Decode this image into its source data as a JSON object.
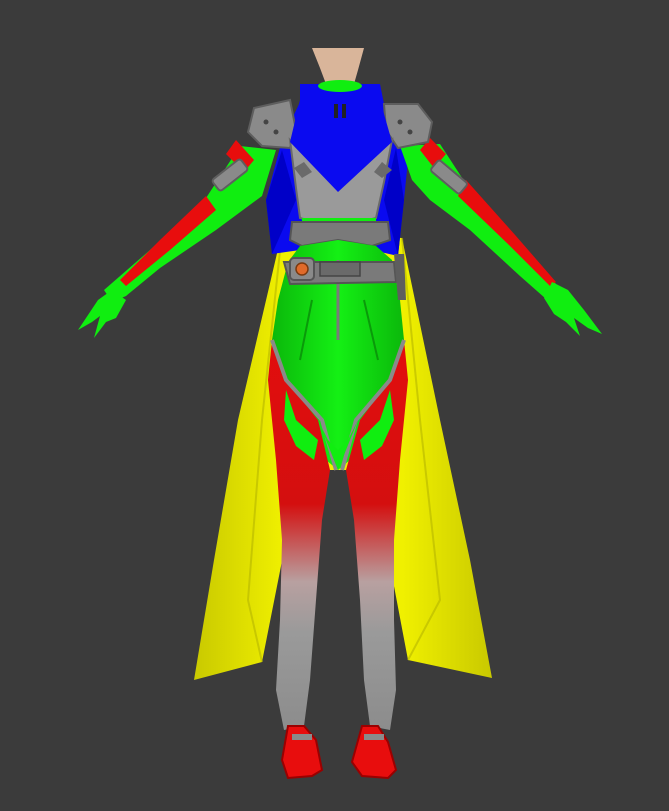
{
  "scene": {
    "background": "#3b3b3b",
    "subject": "costume-model-t-pose",
    "palette": {
      "cape": "#eeee00",
      "cape_shade": "#c8c800",
      "cowl": "#0a0af0",
      "cowl_shade": "#0000b4",
      "bodysuit": "#10ee10",
      "bodysuit_shade": "#0cb00c",
      "panel": "#e80d0d",
      "panel_shade": "#a80000",
      "armor": "#8a8a8a",
      "armor_dark": "#5e5e5e",
      "skin": "#d9b59a",
      "buckle_accent": "#e06a2a"
    }
  }
}
